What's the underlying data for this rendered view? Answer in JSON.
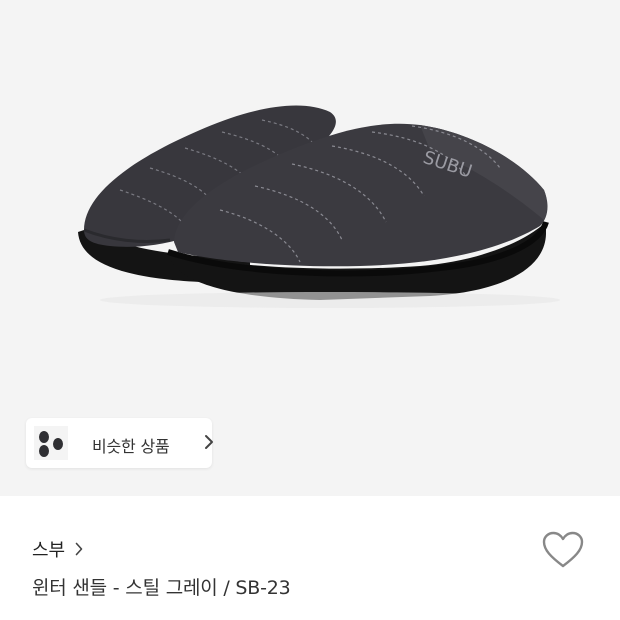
{
  "product": {
    "image_icon": "slipper-product-image",
    "similar_button": {
      "label": "비슷한 상품",
      "icon": "chevron-right-icon"
    },
    "brand": {
      "name": "스부",
      "icon": "chevron-right-icon"
    },
    "title": "윈터 샌들 - 스틸 그레이 / SB-23",
    "like_icon": "heart-outline-icon"
  },
  "colors": {
    "image_background": "#f4f4f4",
    "slipper_body": "#3b3a40",
    "slipper_sole": "#141414",
    "heart_stroke": "#888888"
  }
}
